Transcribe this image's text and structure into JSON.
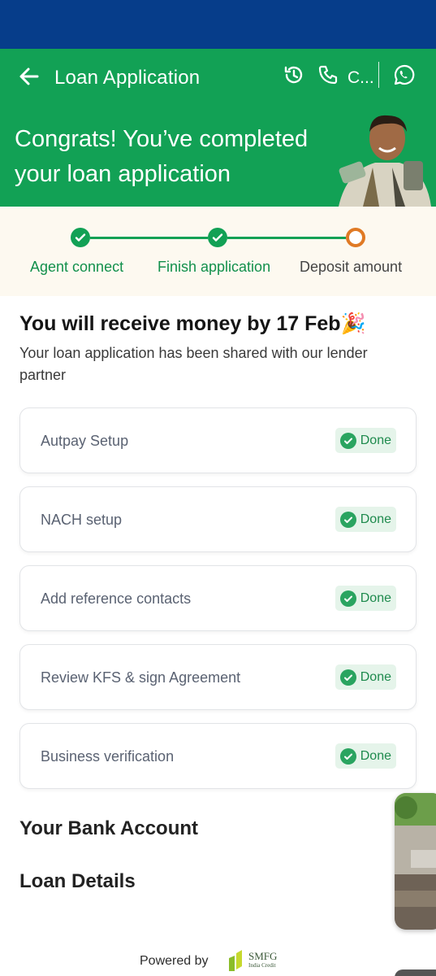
{
  "app_bar": {
    "title": "Loan Application",
    "call_label": "C..."
  },
  "hero": {
    "line1": "Congrats! You’ve completed",
    "line2": "your loan application"
  },
  "stepper": {
    "steps": [
      {
        "label": "Agent connect",
        "state": "done"
      },
      {
        "label": "Finish application",
        "state": "done"
      },
      {
        "label": "Deposit amount",
        "state": "current"
      }
    ]
  },
  "headline": "You will receive money by 17 Feb🎉",
  "subtext": "Your loan application has been shared with our lender partner",
  "tasks": [
    {
      "label": "Autpay Setup",
      "status": "Done"
    },
    {
      "label": "NACH setup",
      "status": "Done"
    },
    {
      "label": "Add reference contacts",
      "status": "Done"
    },
    {
      "label": "Review KFS & sign Agreement",
      "status": "Done"
    },
    {
      "label": "Business verification",
      "status": "Done"
    }
  ],
  "sections": {
    "bank_account": "Your Bank Account",
    "loan_details": "Loan Details"
  },
  "footer": {
    "powered_by": "Powered by",
    "brand": "SMFG",
    "brand_sub": "India Credit"
  },
  "colors": {
    "status_bar": "#063d8a",
    "brand_green": "#12a155",
    "current_step": "#e07a25",
    "badge_bg": "#e5f4ea"
  },
  "icons": [
    "back-arrow-icon",
    "history-icon",
    "phone-icon",
    "whatsapp-icon",
    "check-icon"
  ]
}
